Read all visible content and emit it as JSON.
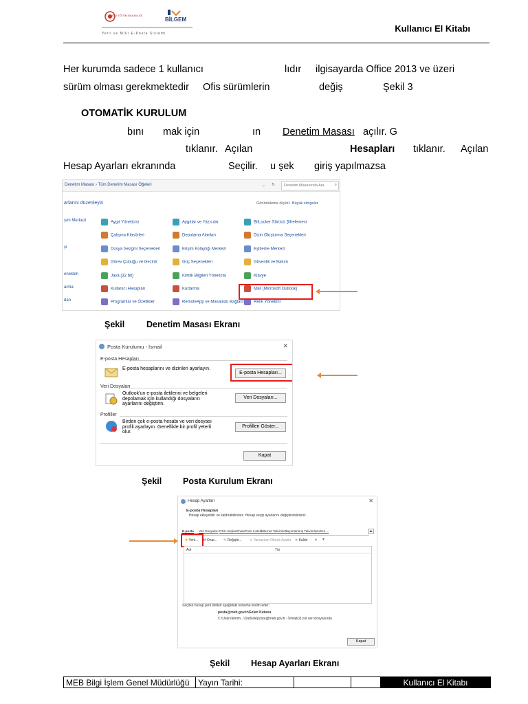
{
  "header": {
    "title": "Kullanıcı El Kitabı",
    "logo_subtitle": "Yerli ve Milli E-Posta Sistemi",
    "logo_org": "BİLGEM",
    "logo_meb": "T.C. MİLLİ EĞİTİM BAKANLIĞI"
  },
  "paragraph1": {
    "l1a": "Her kurumda sadece 1 kullanıcı",
    "l1b": "lıdır",
    "l1c": "ilgisayarda Office 2013 ve üzeri",
    "l2a": "sürüm olması gerekmektedir",
    "l2b": "Ofis sürümlerin",
    "l2c": "değiş",
    "l2d": "Şekil 3"
  },
  "section": {
    "title": "OTOMATİK KURULUM",
    "l1a": "bını",
    "l1b": "mak için",
    "l1c": "ın",
    "l1d": "Denetim Masası",
    "l1e": "açılır. G",
    "l2a": "tıklanır.",
    "l2b": "Açılan",
    "l2c": "Hesapları",
    "l2d": "tıklanır.",
    "l2e": "Açılan",
    "l3a": "Hesap Ayarları ekranında",
    "l3b": "Seçilir.",
    "l3c": "u şek",
    "l3d": "giriş yapılmazsa"
  },
  "figure1": {
    "caption_prefix": "Şekil",
    "caption": "Denetim Masası Ekranı",
    "breadcrumb": "Denetim Masası  ›  Tüm Denetim Masası Öğeleri",
    "search_placeholder": "Denetim Masasında Ara",
    "subheader": "arlarını düzenleyin",
    "view_label": "Görüntüleme ölçütü:",
    "view_value": "Büyük simgeler",
    "items": [
      {
        "label": "şım Merkezi",
        "col": 0,
        "row": 0
      },
      {
        "label": "şi",
        "col": 0,
        "row": 2
      },
      {
        "label": "eneklen",
        "col": 0,
        "row": 4
      },
      {
        "label": "arma",
        "col": 0,
        "row": 5
      },
      {
        "label": "dan",
        "col": 0,
        "row": 6
      },
      {
        "label": "Aygıt Yöneticisi",
        "col": 1,
        "row": 0
      },
      {
        "label": "Çalışma Klasörleri",
        "col": 1,
        "row": 1
      },
      {
        "label": "Dosya Gezgini Seçenekleri",
        "col": 1,
        "row": 2
      },
      {
        "label": "Görev Çubuğu ve Gezinti",
        "col": 1,
        "row": 3
      },
      {
        "label": "Java (32 bit)",
        "col": 1,
        "row": 4
      },
      {
        "label": "Kullanıcı Hesapları",
        "col": 1,
        "row": 5
      },
      {
        "label": "Programlar ve Özellikler",
        "col": 1,
        "row": 6
      },
      {
        "label": "Aygıtlar ve Yazıcılar",
        "col": 2,
        "row": 0
      },
      {
        "label": "Depolama Alanları",
        "col": 2,
        "row": 1
      },
      {
        "label": "Erişim Kolaylığı Merkezi",
        "col": 2,
        "row": 2
      },
      {
        "label": "Güç Seçenekleri",
        "col": 2,
        "row": 3
      },
      {
        "label": "Kimlik Bilgileri Yöneticisi",
        "col": 2,
        "row": 4
      },
      {
        "label": "Kurtarma",
        "col": 2,
        "row": 5
      },
      {
        "label": "RemoteApp ve Masaüstü Bağlantıları",
        "col": 2,
        "row": 6
      },
      {
        "label": "BitLocker Sürücü Şifrelemesi",
        "col": 3,
        "row": 0
      },
      {
        "label": "Dizin Oluşturma Seçenekleri",
        "col": 3,
        "row": 1
      },
      {
        "label": "Eşitleme Merkezi",
        "col": 3,
        "row": 2
      },
      {
        "label": "Güvenlik ve Bakım",
        "col": 3,
        "row": 3
      },
      {
        "label": "Klavye",
        "col": 3,
        "row": 4
      },
      {
        "label": "Mail (Microsoft Outlook)",
        "col": 3,
        "row": 5
      },
      {
        "label": "Renk Yönetimi",
        "col": 3,
        "row": 6
      }
    ]
  },
  "figure2": {
    "caption_prefix": "Şekil",
    "caption": "Posta Kurulum Ekranı",
    "window_title": "Posta Kurulumu - İsmail",
    "close_glyph": "✕",
    "sec1_label": "E-posta Hesapları",
    "sec1_text": "E-posta hesaplarını ve dizinleri ayarlayın.",
    "sec1_button": "E-posta Hesapları...",
    "sec2_label": "Veri Dosyaları",
    "sec2_text": "Outlook'un e-posta iletilerini ve belgeleri depolamak için kullandığı dosyaların ayarlarını değiştirin.",
    "sec2_button": "Veri Dosyaları...",
    "sec3_label": "Profiller",
    "sec3_text": "Birden çok e-posta hesabı ve veri dosyası profili ayarlayın. Genellikle bir profil yeterli olur.",
    "sec3_button": "Profilleri Göster...",
    "close_button": "Kapat"
  },
  "figure3": {
    "caption_prefix": "Şekil",
    "caption": "Hesap Ayarları Ekranı",
    "window_title": "Hesap Ayarları",
    "close_glyph": "✕",
    "heading": "E-posta Hesapları",
    "subheading": "Hesap ekleyebilir ve kaldırabilirsiniz. Hesap seçip ayarlarını değiştirebilirsiniz.",
    "tabs": [
      "E-posta",
      "Veri Dosyaları",
      "RSS Akışları",
      "SharePoint Listeleri",
      "İnternet Takvimleri",
      "Yayımlanmış Takvimler",
      "Adres ..."
    ],
    "toolbar": {
      "new": "Yeni...",
      "repair": "Onar...",
      "change": "Değiştir...",
      "default": "Varsayılan Olarak Ayarla",
      "remove": "Kaldır"
    },
    "col_name": "Adı",
    "col_type": "Tür",
    "footer_text": "Seçilen hesap yeni iletileri aşağıdaki konuma teslim eder:",
    "footer_email": "posta@meb.gov.tr\\Gelen Kutusu",
    "footer_path": "C:\\Users\\kbrim...\\Outlook\\posta@meb.gov.tr - İsmail(2).ost veri dosyasında",
    "close_button": "Kapat"
  },
  "footer": {
    "org": "MEB Bilgi İşlem Genel Müdürlüğü",
    "date_label": "Yayın Tarihi:",
    "title": "Kullanıcı El Kitabı"
  },
  "colors": {
    "highlight": "#e41c1c",
    "arrow": "#e58a3b",
    "link": "#1f4e99"
  }
}
